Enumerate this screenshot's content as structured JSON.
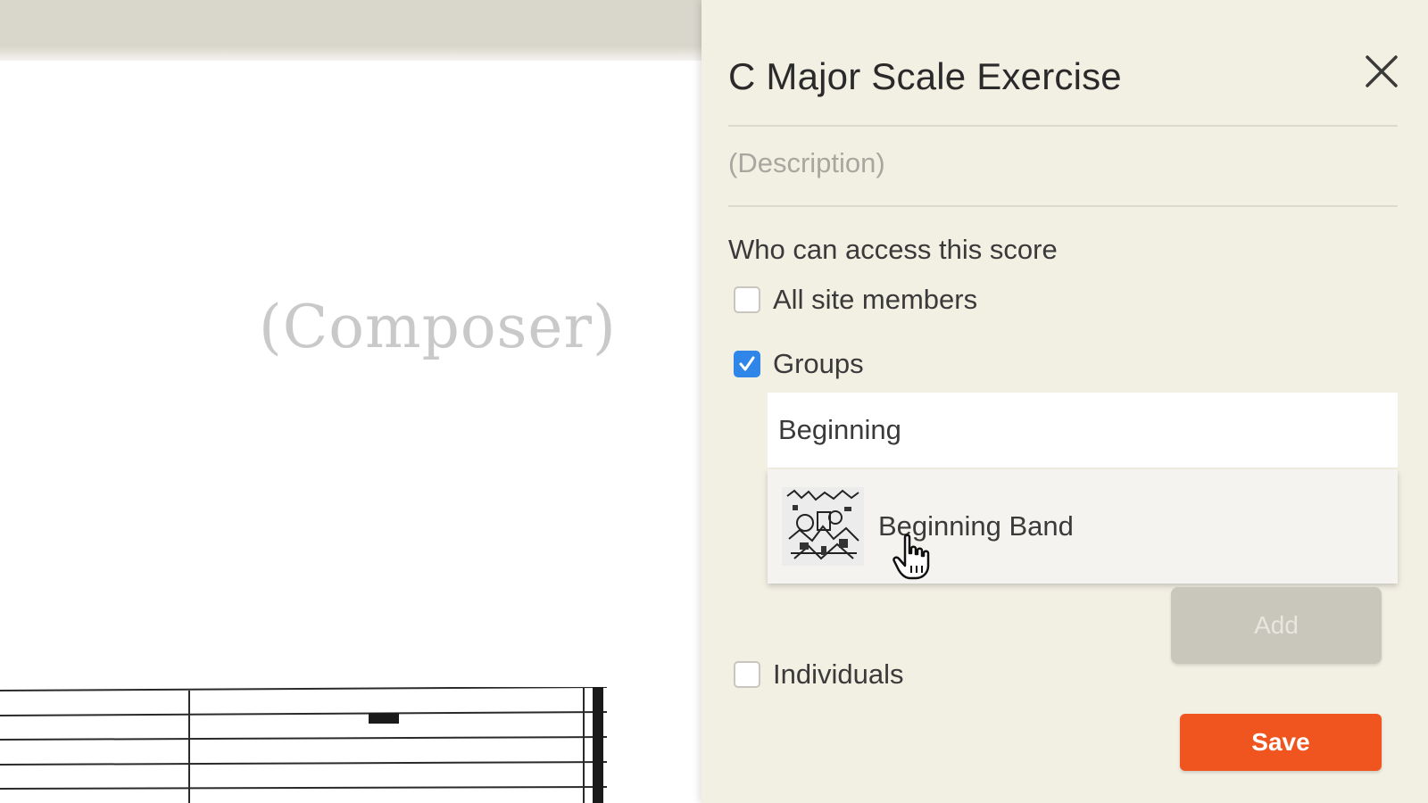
{
  "score": {
    "composer_placeholder": "(Composer)"
  },
  "dialog": {
    "title": "C Major Scale Exercise",
    "close_icon": "close-icon",
    "description_placeholder": "(Description)",
    "access_label": "Who can access this score",
    "options": {
      "all_site_members": {
        "label": "All site members",
        "checked": false
      },
      "groups": {
        "label": "Groups",
        "checked": true
      },
      "individuals": {
        "label": "Individuals",
        "checked": false
      }
    },
    "group_search": {
      "value": "Beginning"
    },
    "group_suggestions": [
      {
        "name": "Beginning Band",
        "icon": "group-thumbnail"
      }
    ],
    "add_label": "Add",
    "save_label": "Save"
  },
  "colors": {
    "panel_bg": "#f2efe3",
    "checkbox_checked": "#2f86e8",
    "save_button": "#f0551f",
    "add_button_disabled": "#c9c7bb"
  }
}
